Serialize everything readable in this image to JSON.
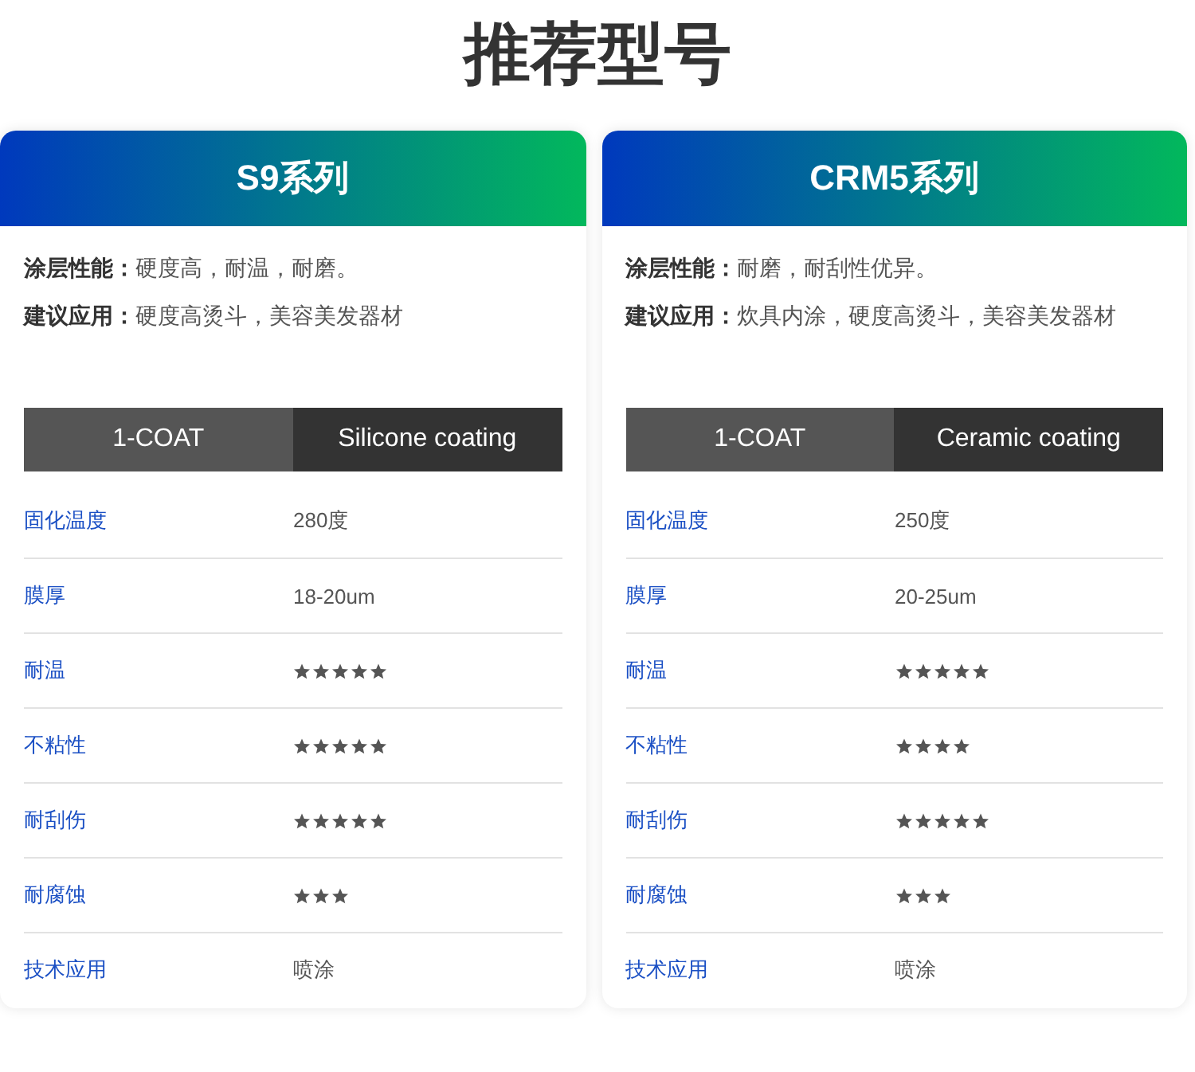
{
  "title": "推荐型号",
  "cards": [
    {
      "header": "S9系列",
      "info": [
        {
          "label": "涂层性能：",
          "value": "硬度高，耐温，耐磨。"
        },
        {
          "label": "建议应用：",
          "value": "硬度高烫斗，美容美发器材"
        }
      ],
      "spec_bar": [
        "1-COAT",
        "Silicone coating"
      ],
      "rows": [
        {
          "kind": "text",
          "label": "固化温度",
          "value": "280度"
        },
        {
          "kind": "text",
          "label": "膜厚",
          "value": "18-20um"
        },
        {
          "kind": "stars",
          "label": "耐温",
          "stars": 5
        },
        {
          "kind": "stars",
          "label": "不粘性",
          "stars": 5
        },
        {
          "kind": "stars",
          "label": "耐刮伤",
          "stars": 5
        },
        {
          "kind": "stars",
          "label": "耐腐蚀",
          "stars": 3
        },
        {
          "kind": "text",
          "label": "技术应用",
          "value": "喷涂"
        }
      ]
    },
    {
      "header": "CRM5系列",
      "info": [
        {
          "label": "涂层性能：",
          "value": "耐磨，耐刮性优异。"
        },
        {
          "label": "建议应用：",
          "value": "炊具内涂，硬度高烫斗，美容美发器材"
        }
      ],
      "spec_bar": [
        "1-COAT",
        "Ceramic coating"
      ],
      "rows": [
        {
          "kind": "text",
          "label": "固化温度",
          "value": "250度"
        },
        {
          "kind": "text",
          "label": "膜厚",
          "value": "20-25um"
        },
        {
          "kind": "stars",
          "label": "耐温",
          "stars": 5
        },
        {
          "kind": "stars",
          "label": "不粘性",
          "stars": 4
        },
        {
          "kind": "stars",
          "label": "耐刮伤",
          "stars": 5
        },
        {
          "kind": "stars",
          "label": "耐腐蚀",
          "stars": 3
        },
        {
          "kind": "text",
          "label": "技术应用",
          "value": "喷涂"
        }
      ]
    }
  ]
}
